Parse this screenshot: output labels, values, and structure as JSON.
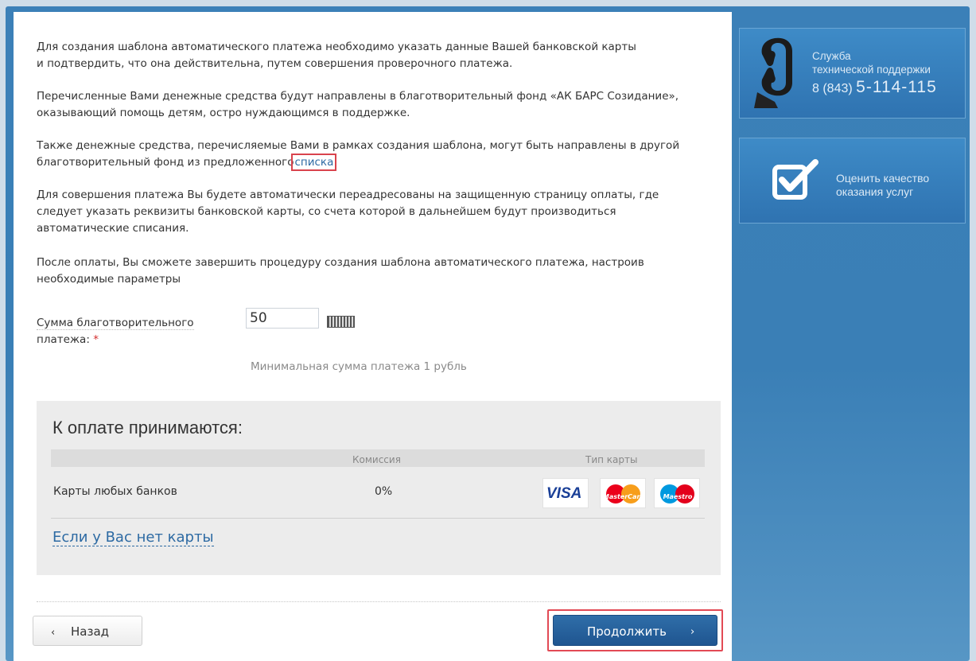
{
  "intro": {
    "p1_line1": "Для создания шаблона автоматического платежа необходимо указать данные Вашей банковской карты",
    "p1_line2": "и подтвердить, что она действительна, путем совершения проверочного платежа.",
    "p2_line1": "Перечисленные Вами денежные средства будут направлены в благотворительный фонд «АК БАРС Созидание»,",
    "p2_line2": "оказывающий помощь детям, остро нуждающимся в поддержке.",
    "p3_line1": "Также денежные средства, перечисляемые Вами в рамках создания шаблона, могут быть направлены в другой",
    "p3_line2_prefix": "благотворительный фонд из предложенного",
    "p3_link": "списка",
    "p4_line1": "Для совершения платежа Вы будете автоматически переадресованы на защищенную страницу оплаты, где",
    "p4_line2": "следует указать реквизиты банковской карты, со счета которой в дальнейшем будут производиться",
    "p4_line3": "автоматические списания.",
    "p5_line1": "После оплаты, Вы сможете завершить процедуру создания шаблона автоматического платежа, настроив",
    "p5_line2": "необходимые параметры"
  },
  "form": {
    "amount_label_line1": "Сумма благотворительного",
    "amount_label_line2": "платежа:",
    "required_mark": "*",
    "amount_value": "50",
    "hint": "Минимальная сумма платежа 1 рубль"
  },
  "payment": {
    "title": "К оплате принимаются:",
    "col_commission": "Комиссия",
    "col_card_type": "Тип карты",
    "row_bank": "Карты любых банков",
    "row_fee": "0%",
    "cards": [
      "VISA",
      "MasterCard",
      "Maestro"
    ],
    "no_card_link": "Если у Вас нет карты"
  },
  "buttons": {
    "back": "Назад",
    "back_icon": "‹",
    "next": "Продолжить",
    "next_icon": "›"
  },
  "sidebar": {
    "support_line1": "Служба",
    "support_line2": "технической поддержки",
    "support_code": "8 (843)",
    "support_number": "5-114-115",
    "rate_line1": "Оценить качество",
    "rate_line2": "оказания услуг"
  },
  "colors": {
    "accent_blue": "#2f73b1",
    "highlight_red": "#e24a55",
    "link": "#2d6aa3"
  }
}
